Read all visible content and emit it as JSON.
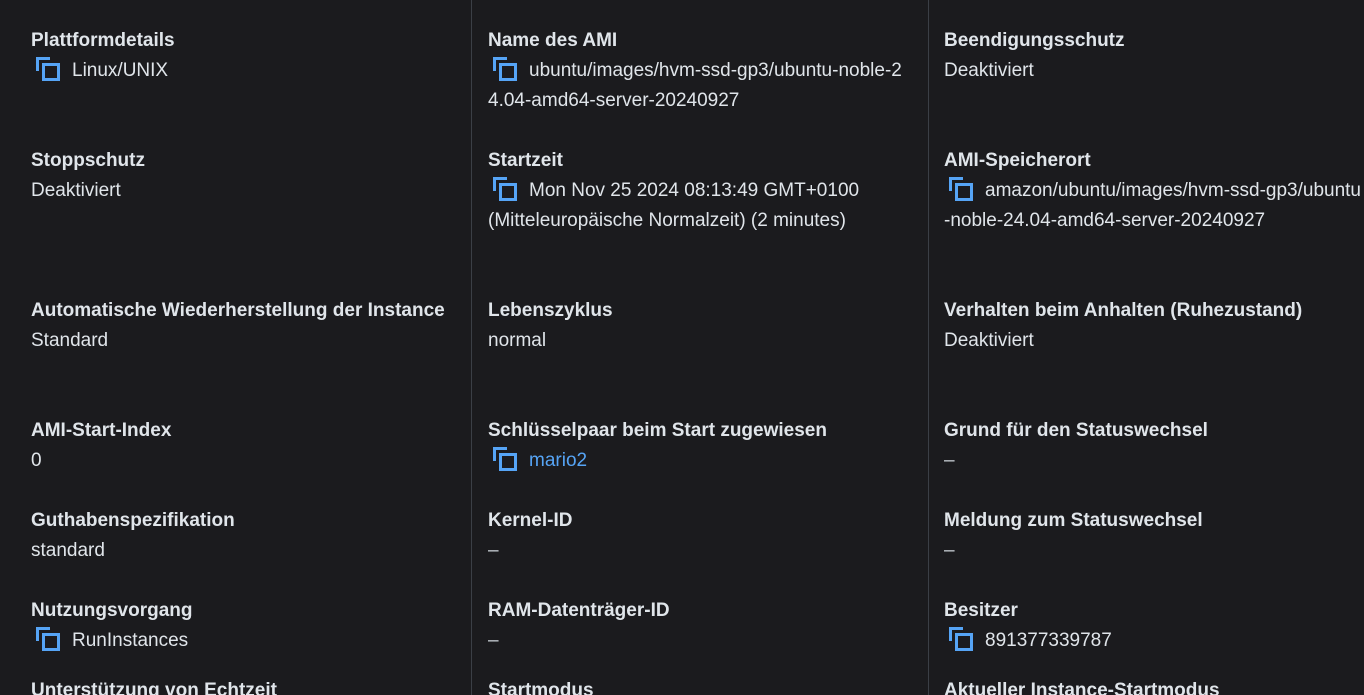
{
  "col1": [
    {
      "label": "Plattformdetails",
      "value": "Linux/UNIX"
    },
    {
      "label": "Stoppschutz",
      "value": "Deaktiviert"
    },
    {
      "label": "Automatische Wiederherstellung der Instance",
      "value": "Standard"
    },
    {
      "label": "AMI-Start-Index",
      "value": "0"
    },
    {
      "label": "Guthabenspezifikation",
      "value": "standard"
    },
    {
      "label": "Nutzungsvorgang",
      "value": "RunInstances"
    },
    {
      "label": "Unterstützung von Echtzeit"
    }
  ],
  "col2": [
    {
      "label": "Name des AMI",
      "value": "ubuntu/images/hvm-ssd-gp3/ubuntu-noble-24.04-amd64-server-20240927"
    },
    {
      "label": "Startzeit",
      "value": "Mon Nov 25 2024 08:13:49 GMT+0100 (Mitteleuropäische Normalzeit) (2 minutes)"
    },
    {
      "label": "Lebenszyklus",
      "value": "normal"
    },
    {
      "label": "Schlüsselpaar beim Start zugewiesen",
      "value": "mario2"
    },
    {
      "label": "Kernel-ID",
      "value": "–"
    },
    {
      "label": "RAM-Datenträger-ID",
      "value": "–"
    },
    {
      "label": "Startmodus"
    }
  ],
  "col3": [
    {
      "label": "Beendigungsschutz",
      "value": "Deaktiviert"
    },
    {
      "label": "AMI-Speicherort",
      "value": "amazon/ubuntu/images/hvm-ssd-gp3/ubuntu-noble-24.04-amd64-server-20240927"
    },
    {
      "label": "Verhalten beim Anhalten (Ruhezustand)",
      "value": "Deaktiviert"
    },
    {
      "label": "Grund für den Statuswechsel",
      "value": "–"
    },
    {
      "label": "Meldung zum Statuswechsel",
      "value": "–"
    },
    {
      "label": "Besitzer",
      "value": "891377339787"
    },
    {
      "label": "Aktueller Instance-Startmodus"
    }
  ]
}
